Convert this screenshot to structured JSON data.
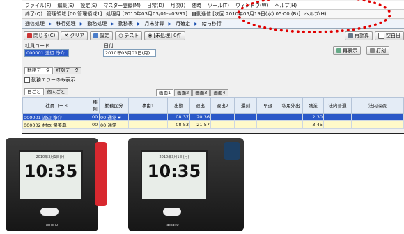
{
  "menu": [
    "ファイル(F)",
    "編集(E)",
    "設定(S)",
    "マスター登録(M)",
    "日常(D)",
    "月次(I)",
    "随時",
    "ツール(T)",
    "ウィンドウ(W)",
    "ヘルプ(H)"
  ],
  "infobar": {
    "exit": "終了(Q)",
    "mgmt": "管理領域 [00 管理領域1]",
    "period": "処理月 [2010年03月03/01～03/31]",
    "auto": "自動通信 [次回 2010年05月19日(水) 05:00 (B)]",
    "help": "ヘルプ(H)"
  },
  "nav": [
    "通信処理",
    "移行処理",
    "勤務処理",
    "勤務表",
    "月末計算",
    "月確定",
    "給与移行"
  ],
  "toolbar": {
    "close": "閉じる(C)",
    "clear": "クリア",
    "settings": "設定",
    "test": "テスト",
    "status": "[未処理] 0件",
    "recalc": "再計算",
    "blank": "空白日",
    "redisplay": "再表示",
    "print": "打刻"
  },
  "form": {
    "emp_label": "社員コード",
    "emp_value": "000001 渡辺 浄介",
    "date_label": "日付",
    "date_value": "2010年03月01日(月)"
  },
  "tabs": [
    "勤務データ",
    "打刻データ"
  ],
  "checkbox_label": "勤務エラーのみ表示",
  "subtabs": [
    "日ごと",
    "個人ごと"
  ],
  "screen_tabs": [
    "画面1",
    "画面2",
    "画面3",
    "画面4"
  ],
  "headers": [
    "社員コード",
    "種別",
    "勤務区分",
    "事由1",
    "出勤",
    "退出",
    "退出2",
    "遅刻",
    "早退",
    "私用外出",
    "残業",
    "法内普通",
    "法内深夜"
  ],
  "rows": [
    {
      "code": "000001",
      "name": "渡辺 浄介",
      "kind": "00",
      "shift": "00 通常",
      "in": "08:37",
      "out": "20:36",
      "ot": "2:30"
    },
    {
      "code": "000002",
      "name": "村本 保美典",
      "kind": "00",
      "shift": "00 通常",
      "in": "08:53",
      "out": "21:57",
      "ot": "3:45"
    }
  ],
  "device": {
    "time": "10:35",
    "sub": "2010年3月1日(月)",
    "brand": "amano"
  }
}
